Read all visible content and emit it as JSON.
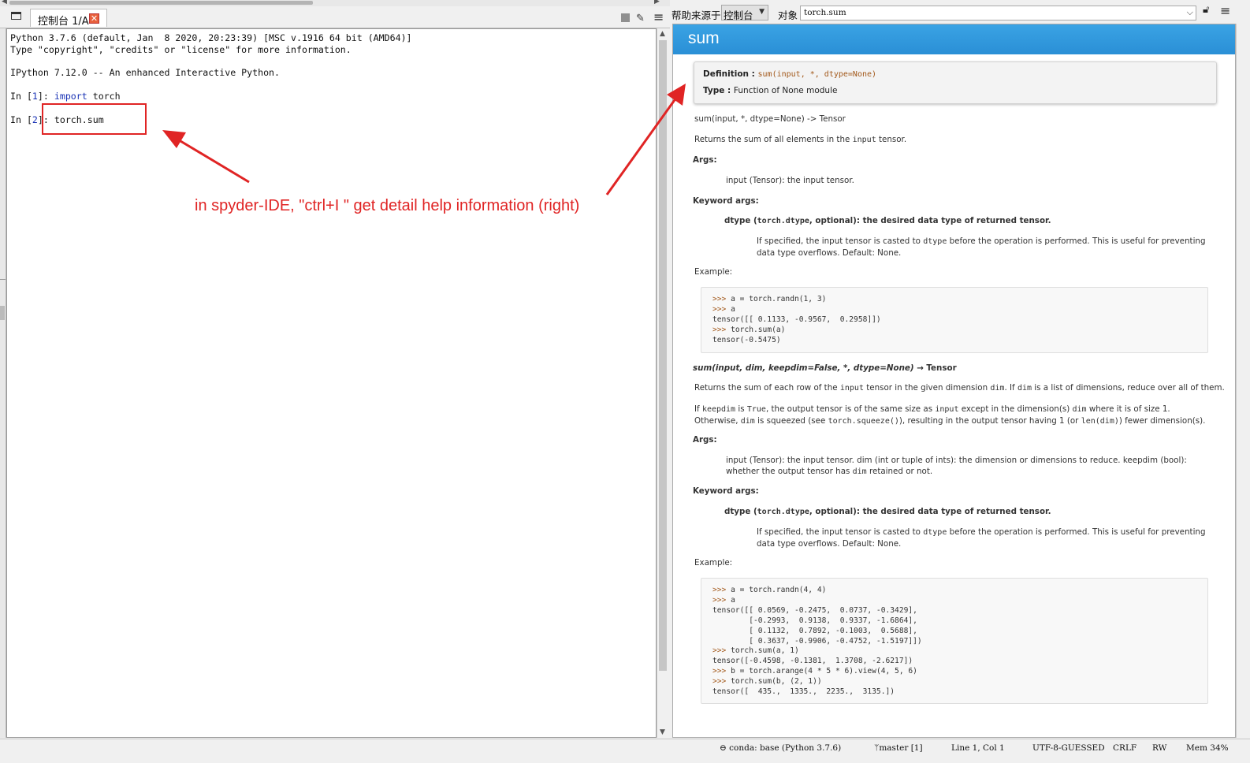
{
  "console": {
    "tab_label": "控制台 1/A",
    "close_glyph": "✕",
    "banner_line1": "Python 3.7.6 (default, Jan  8 2020, 20:23:39) [MSC v.1916 64 bit (AMD64)]",
    "banner_line2": "Type \"copyright\", \"credits\" or \"license\" for more information.",
    "ipython_line": "IPython 7.12.0 -- An enhanced Interactive Python.",
    "in1_prompt_open": "In [",
    "in1_num": "1",
    "in1_prompt_close": "]: ",
    "in1_keyword": "import",
    "in1_rest": " torch",
    "in2_prompt_open": "In [",
    "in2_num": "2",
    "in2_prompt_close": "]: ",
    "in2_code": "torch.sum"
  },
  "annotation": {
    "text": "in spyder-IDE, \"ctrl+I \" get detail help information (right)",
    "color": "#e02424"
  },
  "help_toolbar": {
    "source_label": "帮助来源于",
    "source_value": "控制台",
    "object_label": "对象",
    "object_value": "torch.sum"
  },
  "help": {
    "title": "sum",
    "definition_label": "Definition : ",
    "definition_value": "sum(input, *, dtype=None)",
    "type_label": "Type : ",
    "type_value": "Function of None module",
    "sig1": "sum(input, *, dtype=None) -> Tensor",
    "desc1_a": "Returns the sum of all elements in the ",
    "desc1_code": "input",
    "desc1_b": " tensor.",
    "args_label_1": "Args:",
    "args_text_1": "input (Tensor): the input tensor.",
    "kwargs_label_1": "Keyword args:",
    "kw_head_a": "dtype (",
    "kw_head_code": "torch.dtype",
    "kw_head_b": ", optional): the desired data type of returned tensor.",
    "kw_detail_a": "If specified, the input tensor is casted to ",
    "kw_detail_code": "dtype",
    "kw_detail_b": " before the operation is performed. This is useful for preventing data type overflows. Default: None.",
    "example_label_1": "Example:",
    "code1": [
      [
        ">>> ",
        "a = torch.randn(1, 3)"
      ],
      [
        ">>> ",
        "a"
      ],
      [
        "",
        "tensor([[ 0.1133, -0.9567,  0.2958]])"
      ],
      [
        ">>> ",
        "torch.sum(a)"
      ],
      [
        "",
        "tensor(-0.5475)"
      ]
    ],
    "sig2_a": "sum(input, dim, keepdim=False, *, dtype=None)",
    "sig2_b": " → Tensor",
    "desc2_a": "Returns the sum of each row of the ",
    "desc2_code1": "input",
    "desc2_b": " tensor in the given dimension ",
    "desc2_code2": "dim",
    "desc2_c": ". If ",
    "desc2_code3": "dim",
    "desc2_d": " is a list of dimensions, reduce over all of them.",
    "desc3_a": "If ",
    "desc3_c1": "keepdim",
    "desc3_b": " is ",
    "desc3_c2": "True",
    "desc3_c": ", the output tensor is of the same size as ",
    "desc3_c3": "input",
    "desc3_d": " except in the dimension(s) ",
    "desc3_c4": "dim",
    "desc3_e": " where it is of size 1. Otherwise, ",
    "desc3_c5": "dim",
    "desc3_f": " is squeezed (see ",
    "desc3_c6": "torch.squeeze()",
    "desc3_g": "), resulting in the output tensor having 1 (or ",
    "desc3_c7": "len(dim)",
    "desc3_h": ") fewer dimension(s).",
    "args_label_2": "Args:",
    "args_text_2a": "input (Tensor): the input tensor. dim (int or tuple of ints): the dimension or dimensions to reduce. keepdim (bool): whether the output tensor has ",
    "args_text_2code": "dim",
    "args_text_2b": " retained or not.",
    "kwargs_label_2": "Keyword args:",
    "example_label_2": "Example:",
    "code2": [
      [
        ">>> ",
        "a = torch.randn(4, 4)"
      ],
      [
        ">>> ",
        "a"
      ],
      [
        "",
        "tensor([[ 0.0569, -0.2475,  0.0737, -0.3429],"
      ],
      [
        "",
        "        [-0.2993,  0.9138,  0.9337, -1.6864],"
      ],
      [
        "",
        "        [ 0.1132,  0.7892, -0.1003,  0.5688],"
      ],
      [
        "",
        "        [ 0.3637, -0.9906, -0.4752, -1.5197]])"
      ],
      [
        ">>> ",
        "torch.sum(a, 1)"
      ],
      [
        "",
        "tensor([-0.4598, -0.1381,  1.3708, -2.6217])"
      ],
      [
        ">>> ",
        "b = torch.arange(4 * 5 * 6).view(4, 5, 6)"
      ],
      [
        ">>> ",
        "torch.sum(b, (2, 1))"
      ],
      [
        "",
        "tensor([  435.,  1335.,  2235.,  3135.])"
      ]
    ]
  },
  "statusbar": {
    "conda": "conda: base (Python 3.7.6)",
    "git": "master [1]",
    "position": "Line 1, Col 1",
    "encoding": "UTF-8-GUESSED",
    "eol": "CRLF",
    "perm": "RW",
    "mem": "Mem 34%"
  },
  "icons": {
    "browse": "browse-tabs-icon",
    "stop": "stop-icon",
    "eraser": "clear-console-icon",
    "menu": "hamburger-menu-icon",
    "lock": "lock-icon",
    "conda": "conda-icon",
    "git": "git-branch-icon"
  }
}
